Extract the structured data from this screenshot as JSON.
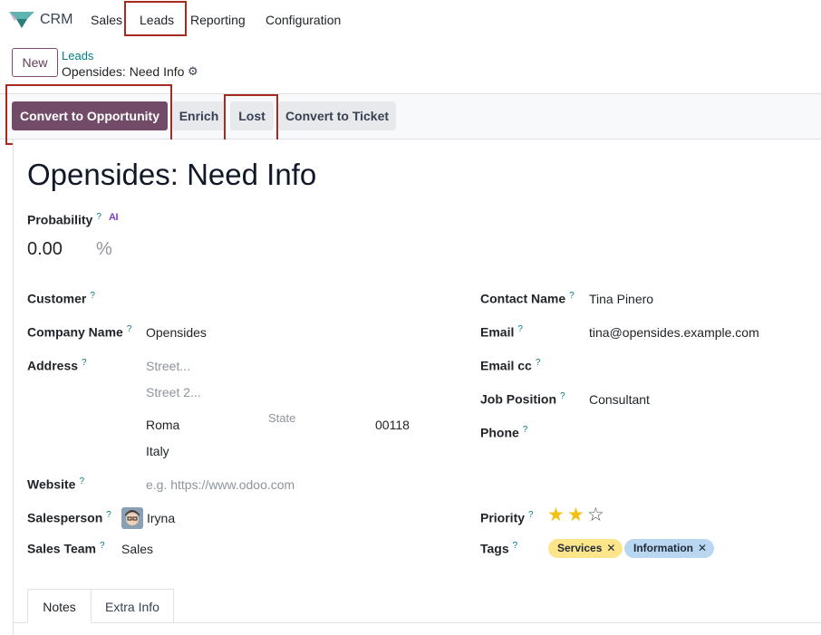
{
  "app": {
    "name": "CRM",
    "menu": [
      "Sales",
      "Leads",
      "Reporting",
      "Configuration"
    ]
  },
  "breadcrumb": {
    "new_label": "New",
    "parent": "Leads",
    "current": "Opensides: Need Info",
    "gear_icon": "gear-icon"
  },
  "actions": {
    "convert_opportunity": "Convert to Opportunity",
    "enrich": "Enrich",
    "lost": "Lost",
    "convert_ticket": "Convert to Ticket"
  },
  "form": {
    "title": "Opensides: Need Info",
    "probability": {
      "label": "Probability",
      "help": "?",
      "ai_badge": "AI",
      "value": "0.00",
      "unit": "%"
    },
    "left": {
      "customer": {
        "label": "Customer",
        "help": "?",
        "value": ""
      },
      "company_name": {
        "label": "Company Name",
        "help": "?",
        "value": "Opensides"
      },
      "address": {
        "label": "Address",
        "help": "?",
        "street_placeholder": "Street...",
        "street2_placeholder": "Street 2...",
        "city": "Roma",
        "state_placeholder": "State",
        "zip": "00118",
        "country": "Italy"
      },
      "website": {
        "label": "Website",
        "help": "?",
        "placeholder": "e.g. https://www.odoo.com"
      },
      "salesperson": {
        "label": "Salesperson",
        "help": "?",
        "value": "Iryna"
      },
      "sales_team": {
        "label": "Sales Team",
        "help": "?",
        "value": "Sales"
      }
    },
    "right": {
      "contact_name": {
        "label": "Contact Name",
        "help": "?",
        "value": "Tina Pinero"
      },
      "email": {
        "label": "Email",
        "help": "?",
        "value": "tina@opensides.example.com"
      },
      "email_cc": {
        "label": "Email cc",
        "help": "?",
        "value": ""
      },
      "job_position": {
        "label": "Job Position",
        "help": "?",
        "value": "Consultant"
      },
      "phone": {
        "label": "Phone",
        "help": "?",
        "value": ""
      },
      "priority": {
        "label": "Priority",
        "help": "?",
        "stars_filled": 2,
        "stars_total": 3
      },
      "tags": {
        "label": "Tags",
        "help": "?",
        "items": [
          {
            "name": "Services",
            "color": "#fce58b"
          },
          {
            "name": "Information",
            "color": "#b9d7f1"
          }
        ]
      }
    }
  },
  "notebook": {
    "tabs": [
      "Notes",
      "Extra Info"
    ]
  },
  "colors": {
    "primary": "#714b67",
    "link": "#017e84",
    "highlight": "#a52a1f",
    "star": "#f3c010"
  }
}
